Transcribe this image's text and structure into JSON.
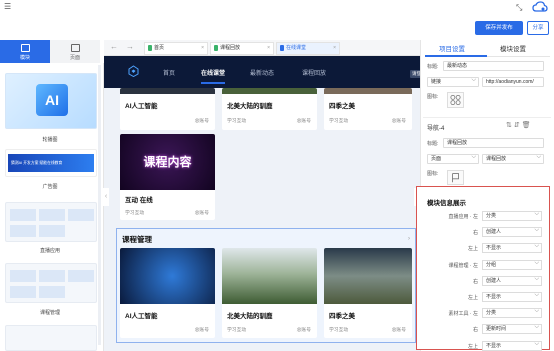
{
  "toolbar": {
    "publish_label": "保存并发布",
    "share_label": "分享"
  },
  "left_panel": {
    "tabs": [
      {
        "label": "模块"
      },
      {
        "label": "页面"
      }
    ],
    "items": [
      {
        "label": "轮播图",
        "image_text": "AI"
      },
      {
        "label": "广告图",
        "image_text": "猜测AI 开发方案 赋能在线教育"
      },
      {
        "label": "直播应用"
      },
      {
        "label": "课程管理"
      }
    ]
  },
  "browser_tabs": [
    {
      "label": "首页"
    },
    {
      "label": "课程回放"
    },
    {
      "label": "在线课堂"
    }
  ],
  "site_nav": {
    "items": [
      "首页",
      "在线课堂",
      "最新动态",
      "课程回放"
    ],
    "active": "在线课堂",
    "login": "请登"
  },
  "cards_top": [
    {
      "title": "AI人工智能",
      "sub": "",
      "meta": "总账号"
    },
    {
      "title": "北美大陆的驯鹿",
      "sub": "学习互动",
      "meta": "总账号"
    },
    {
      "title": "四季之美",
      "sub": "学习互动",
      "meta": "总账号"
    },
    {
      "title": "互动 在线",
      "image_text": "课程内容",
      "sub": "学习互动",
      "meta": "总账号"
    }
  ],
  "section": {
    "title": "课程管理"
  },
  "cards_section": [
    {
      "title": "AI人工智能",
      "meta": "总账号"
    },
    {
      "title": "北美大陆的驯鹿",
      "sub": "学习互动",
      "meta": "总账号"
    },
    {
      "title": "四季之美",
      "sub": "学习互动",
      "meta": "总账号"
    }
  ],
  "right_panel": {
    "tabs": [
      "项目设置",
      "模块设置"
    ],
    "title_label": "标题:",
    "title_value": "最新动态",
    "link_type": "链接",
    "link_value": "http://aodianyun.com/",
    "icon_label": "图标:",
    "nav4_label": "导航-4",
    "nav4_title_value": "课程回放",
    "nav4_type": "页面",
    "nav4_page": "课程回放",
    "info_title": "模块信息展示",
    "info_rows": [
      {
        "label": "直播应用 · 左",
        "value": "分类"
      },
      {
        "label": "右",
        "value": "创建人"
      },
      {
        "label": "左上",
        "value": "不显示"
      },
      {
        "label": "课程管理 · 左",
        "value": "分组"
      },
      {
        "label": "右",
        "value": "创建人"
      },
      {
        "label": "左上",
        "value": "不显示"
      },
      {
        "label": "素材工具 · 左",
        "value": "分类"
      },
      {
        "label": "右",
        "value": "更新时间"
      },
      {
        "label": "左上",
        "value": "不显示"
      }
    ]
  },
  "colors": {
    "accent": "#2a6be6",
    "nav_bg": "#0c1938",
    "highlight": "#d9534f"
  }
}
